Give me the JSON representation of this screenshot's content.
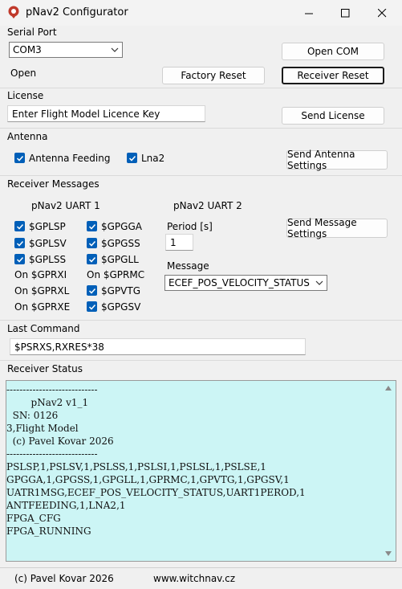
{
  "window": {
    "title": "pNav2 Configurator",
    "minimize_glyph": "—",
    "maximize_glyph": "☐",
    "close_glyph": "✕"
  },
  "serial_port": {
    "label": "Serial Port",
    "port_value": "COM3",
    "status_text": "Open",
    "open_com_button": "Open COM",
    "factory_reset_button": "Factory Reset",
    "receiver_reset_button": "Receiver Reset"
  },
  "license": {
    "label": "License",
    "placeholder": "Enter Flight Model Licence Key",
    "send_button": "Send License"
  },
  "antenna": {
    "label": "Antenna",
    "antenna_feeding": {
      "label": "Antenna Feeding",
      "checked": true
    },
    "lna2": {
      "label": "Lna2",
      "checked": true
    },
    "send_button": "Send Antenna Settings"
  },
  "receiver_messages": {
    "label": "Receiver Messages",
    "uart1_label": "pNav2 UART 1",
    "uart2_label": "pNav2 UART 2",
    "col1": [
      {
        "label": "$GPLSP",
        "checked": true
      },
      {
        "label": "$GPLSV",
        "checked": true
      },
      {
        "label": "$GPLSS",
        "checked": true
      },
      {
        "label": "On $GPRXI",
        "checked": false
      },
      {
        "label": "On $GPRXL",
        "checked": false
      },
      {
        "label": "On $GPRXE",
        "checked": false
      }
    ],
    "col2": [
      {
        "label": "$GPGGA",
        "checked": true
      },
      {
        "label": "$GPGSS",
        "checked": true
      },
      {
        "label": "$GPGLL",
        "checked": true
      },
      {
        "label": "On $GPRMC",
        "checked": false
      },
      {
        "label": "$GPVTG",
        "checked": true
      },
      {
        "label": "$GPGSV",
        "checked": true
      }
    ],
    "period_label": "Period [s]",
    "period_value": "1",
    "message_label": "Message",
    "message_value": "ECEF_POS_VELOCITY_STATUS",
    "send_button": "Send Message Settings"
  },
  "last_command": {
    "label": "Last Command",
    "value": "$PSRXS,RXRES*38"
  },
  "receiver_status": {
    "label": "Receiver Status",
    "text": "----------------------------\n        pNav2 v1_1\n  SN: 0126\n3,Flight Model\n  (c) Pavel Kovar 2026\n----------------------------\nPSLSP,1,PSLSV,1,PSLSS,1,PSLSI,1,PSLSL,1,PSLSE,1\nGPGGA,1,GPGSS,1,GPGLL,1,GPRMC,1,GPVTG,1,GPGSV,1\nUATR1MSG,ECEF_POS_VELOCITY_STATUS,UART1PEROD,1\nANTFEEDING,1,LNA2,1\nFPGA_CFG\nFPGA_RUNNING"
  },
  "footer": {
    "copyright": "(c) Pavel Kovar 2026",
    "website": "www.witchnav.cz"
  },
  "colors": {
    "checkbox_accent": "#005fb8",
    "status_background": "#ccf5f5"
  },
  "icons": {
    "app": "location-pin-icon",
    "dropdown": "chevron-down-icon",
    "check": "checkmark-icon"
  }
}
